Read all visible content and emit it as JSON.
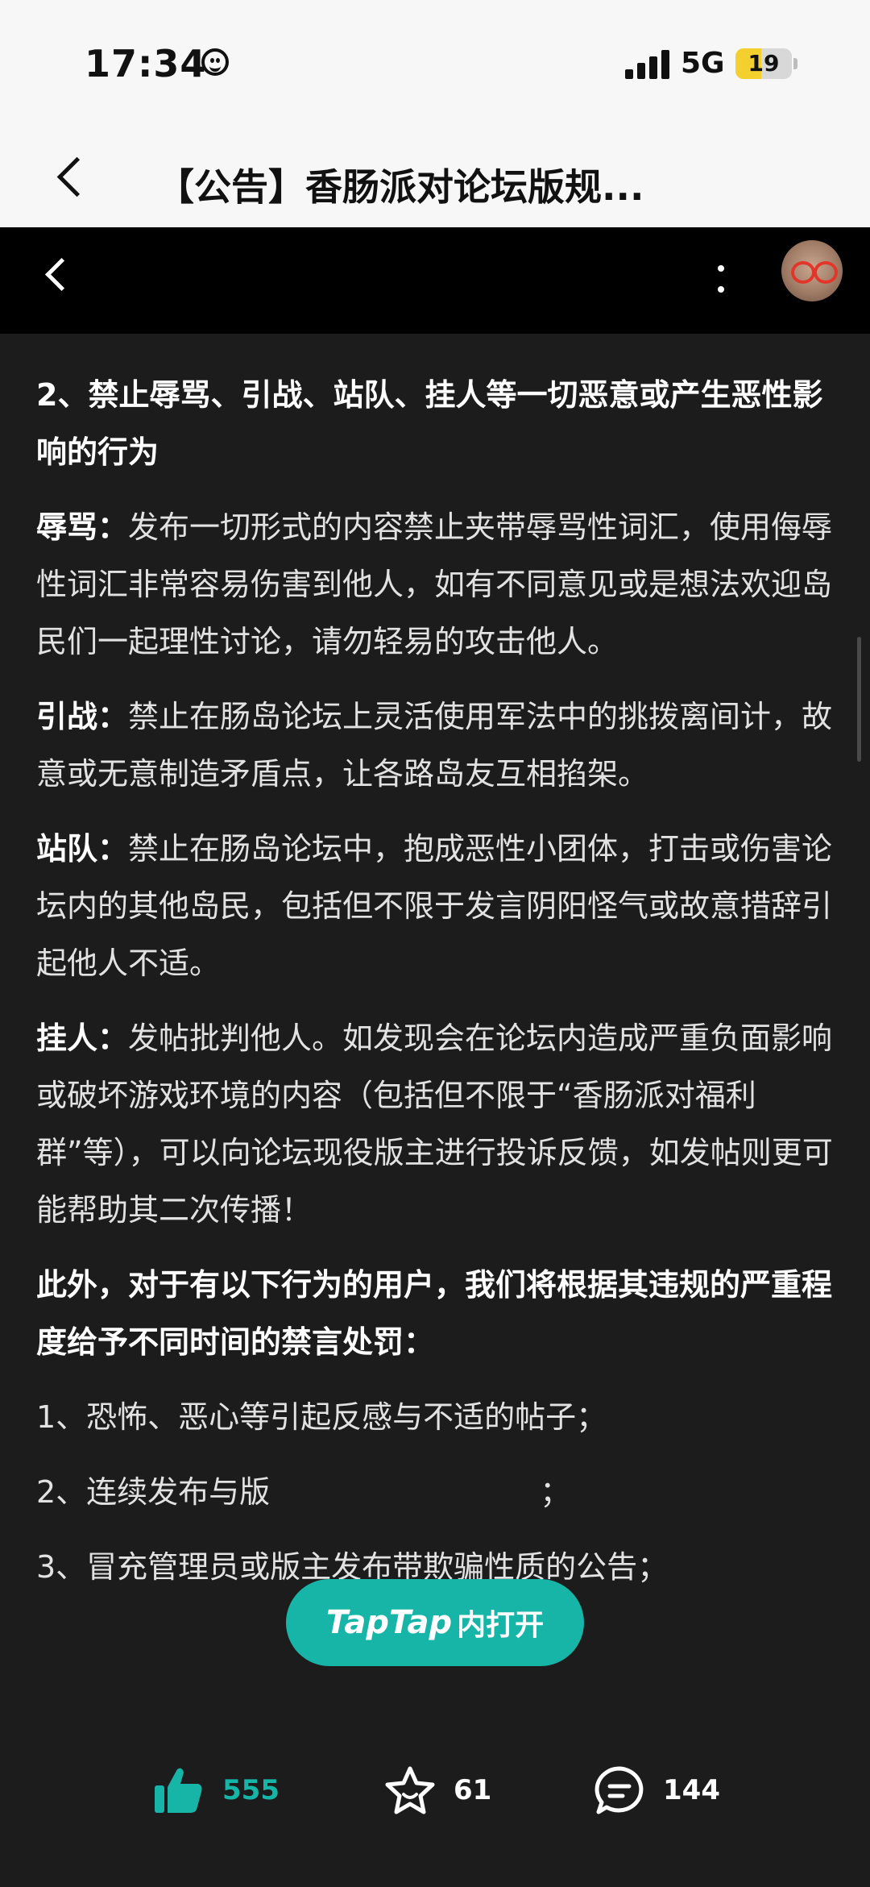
{
  "status_bar": {
    "time": "17:34",
    "network": "5G",
    "battery": "19"
  },
  "header": {
    "title": "【公告】香肠派对论坛版规..."
  },
  "article": {
    "section_title": "2、禁止辱骂、引战、站队、挂人等一切恶意或产生恶性影响的行为",
    "rules": [
      {
        "term": "辱骂：",
        "text": "发布一切形式的内容禁止夹带辱骂性词汇，使用侮辱性词汇非常容易伤害到他人，如有不同意见或是想法欢迎岛民们一起理性讨论，请勿轻易的攻击他人。"
      },
      {
        "term": "引战：",
        "text": "禁止在肠岛论坛上灵活使用军法中的挑拨离间计，故意或无意制造矛盾点，让各路岛友互相掐架。"
      },
      {
        "term": "站队：",
        "text": "禁止在肠岛论坛中，抱成恶性小团体，打击或伤害论坛内的其他岛民，包括但不限于发言阴阳怪气或故意措辞引起他人不适。"
      },
      {
        "term": "挂人：",
        "text": "发帖批判他人。如发现会在论坛内造成严重负面影响或破坏游戏环境的内容（包括但不限于“香肠派对福利群”等），可以向论坛现役版主进行投诉反馈，如发帖则更可能帮助其二次传播！"
      }
    ],
    "penalty_intro": "此外，对于有以下行为的用户，我们将根据其违规的严重程度给予不同时间的禁言处罚：",
    "penalties": [
      "1、恐怖、恶心等引起反感与不适的帖子；",
      "2、连续发布与版",
      "；",
      "3、冒充管理员或版主发布带欺骗性质的公告；"
    ]
  },
  "open_app": {
    "brand": "TapTap",
    "label": "内打开"
  },
  "actions": {
    "likes": "555",
    "favorites": "61",
    "comments": "144"
  },
  "colors": {
    "accent": "#17b5a7",
    "background": "#1c1c1c"
  }
}
